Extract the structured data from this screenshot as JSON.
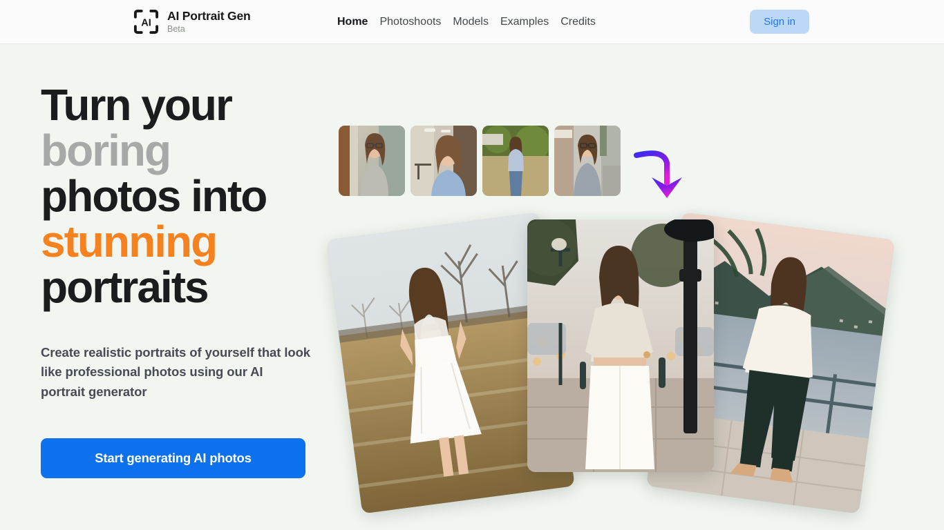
{
  "theme": {
    "page_bg": "#f1f6f0",
    "header_bg": "#fafbfa",
    "accent_orange": "#f5821f",
    "accent_blue": "#0b71ef",
    "signin_bg": "#bcd8f7",
    "signin_text": "#2176ec",
    "headline_dark": "#1a1c1e",
    "headline_grey": "#a7a9a8",
    "arrow_gradient_start": "#3b2bef",
    "arrow_gradient_end": "#e21fd6"
  },
  "header": {
    "brand": {
      "icon": "ai-scan-frame-icon",
      "title": "AI Portrait Gen",
      "subtitle": "Beta"
    },
    "nav": [
      {
        "label": "Home",
        "active": true
      },
      {
        "label": "Photoshoots",
        "active": false
      },
      {
        "label": "Models",
        "active": false
      },
      {
        "label": "Examples",
        "active": false
      },
      {
        "label": "Credits",
        "active": false
      }
    ],
    "signin_label": "Sign in"
  },
  "hero": {
    "headline": {
      "line1": "Turn your",
      "line2": "boring",
      "line3": "photos into",
      "line4": "stunning",
      "line5": "portraits"
    },
    "subhead": "Create realistic portraits of yourself that look like professional photos using our AI portrait generator",
    "cta_label": "Start generating AI photos",
    "arrow_icon": "curved-down-arrow-icon",
    "thumbnails": [
      {
        "name": "input-photo-1",
        "alt": "Woman with glasses in grey sweater indoors"
      },
      {
        "name": "input-photo-2",
        "alt": "Woman in light blue shirt in hallway"
      },
      {
        "name": "input-photo-3",
        "alt": "Woman in light blue sweater and jeans outdoors"
      },
      {
        "name": "input-photo-4",
        "alt": "Woman with glasses in grey top on street"
      }
    ],
    "collage": [
      {
        "name": "result-photo-left",
        "alt": "Woman in white lace dress in a winter field",
        "rotation": -7.5
      },
      {
        "name": "result-photo-center",
        "alt": "Woman in cream top and white trousers on city street at dusk",
        "rotation": 0
      },
      {
        "name": "result-photo-right",
        "alt": "Woman in cream sweater and dark trousers by a lakeside railing",
        "rotation": 7.5
      }
    ]
  }
}
